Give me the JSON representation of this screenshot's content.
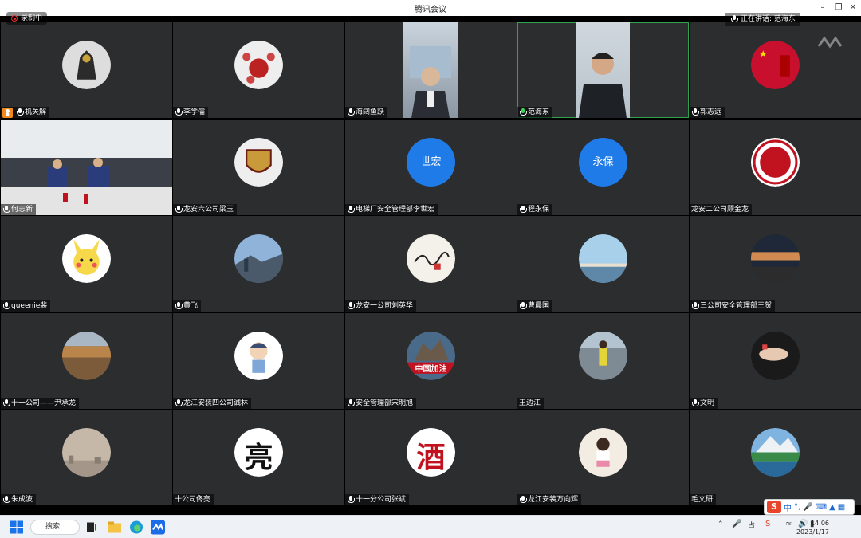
{
  "window": {
    "title": "腾讯会议"
  },
  "indicators": {
    "recording": "录制中",
    "speaking": "正在讲话: 范海东"
  },
  "tiles": [
    {
      "name": "机关解",
      "row": 0,
      "col": 0,
      "kind": "avatar",
      "avatar": "ironman",
      "badge": true
    },
    {
      "name": "李学儒",
      "row": 0,
      "col": 1,
      "kind": "avatar",
      "avatar": "teaset"
    },
    {
      "name": "海阔鱼跃",
      "row": 0,
      "col": 2,
      "kind": "video",
      "video": "man-office"
    },
    {
      "name": "范海东",
      "row": 0,
      "col": 3,
      "kind": "video",
      "video": "man-speaking",
      "speaking": true
    },
    {
      "name": "郭志远",
      "row": 0,
      "col": 4,
      "kind": "avatar",
      "avatar": "red-flag"
    },
    {
      "name": "何志新",
      "row": 1,
      "col": 0,
      "kind": "video",
      "video": "meeting-room"
    },
    {
      "name": "龙安六公司梁玉",
      "row": 1,
      "col": 1,
      "kind": "avatar",
      "avatar": "gold-emblem"
    },
    {
      "name": "电梯厂安全管理部李世宏",
      "row": 1,
      "col": 2,
      "kind": "text",
      "initials": "世宏"
    },
    {
      "name": "程永保",
      "row": 1,
      "col": 3,
      "kind": "text",
      "initials": "永保"
    },
    {
      "name": "龙安二公司顾金龙",
      "row": 1,
      "col": 4,
      "kind": "avatar",
      "avatar": "red-seal",
      "nomic": true
    },
    {
      "name": "queenie裴",
      "row": 2,
      "col": 0,
      "kind": "avatar",
      "avatar": "pikachu"
    },
    {
      "name": "黄飞",
      "row": 2,
      "col": 1,
      "kind": "avatar",
      "avatar": "mountain-view"
    },
    {
      "name": "龙安一公司刘英华",
      "row": 2,
      "col": 2,
      "kind": "avatar",
      "avatar": "signature"
    },
    {
      "name": "曹晨国",
      "row": 2,
      "col": 3,
      "kind": "avatar",
      "avatar": "sky-sea"
    },
    {
      "name": "三公司安全管理部王贺",
      "row": 2,
      "col": 4,
      "kind": "avatar",
      "avatar": "sunset"
    },
    {
      "name": "十一公司——尹承龙",
      "row": 3,
      "col": 0,
      "kind": "avatar",
      "avatar": "autumn-field"
    },
    {
      "name": "龙江安装四公司诚林",
      "row": 3,
      "col": 1,
      "kind": "avatar",
      "avatar": "cartoon-boy"
    },
    {
      "name": "安全管理部宋明旭",
      "row": 3,
      "col": 2,
      "kind": "avatar",
      "avatar": "china-jiayou",
      "avatar_text": "中国加油"
    },
    {
      "name": "王边江",
      "row": 3,
      "col": 3,
      "kind": "avatar",
      "avatar": "person-outdoor",
      "nomic": true
    },
    {
      "name": "文明",
      "row": 3,
      "col": 4,
      "kind": "avatar",
      "avatar": "dark-photo"
    },
    {
      "name": "朱成波",
      "row": 4,
      "col": 0,
      "kind": "avatar",
      "avatar": "hazy-city"
    },
    {
      "name": "十公司佟亮",
      "row": 4,
      "col": 1,
      "kind": "avatar",
      "avatar": "calligraphy",
      "avatar_text": "亮",
      "nomic": true
    },
    {
      "name": "十一分公司张斌",
      "row": 4,
      "col": 2,
      "kind": "avatar",
      "avatar": "red-calligraphy",
      "avatar_text": "酒"
    },
    {
      "name": "龙江安装万向辉",
      "row": 4,
      "col": 3,
      "kind": "avatar",
      "avatar": "child"
    },
    {
      "name": "毛文研",
      "row": 4,
      "col": 4,
      "kind": "avatar",
      "avatar": "lake-mountain",
      "nomic": true
    }
  ],
  "taskbar": {
    "search_label": "搜索",
    "time": "14:06",
    "date": "2023/1/17"
  },
  "ime": {
    "label": "中"
  }
}
